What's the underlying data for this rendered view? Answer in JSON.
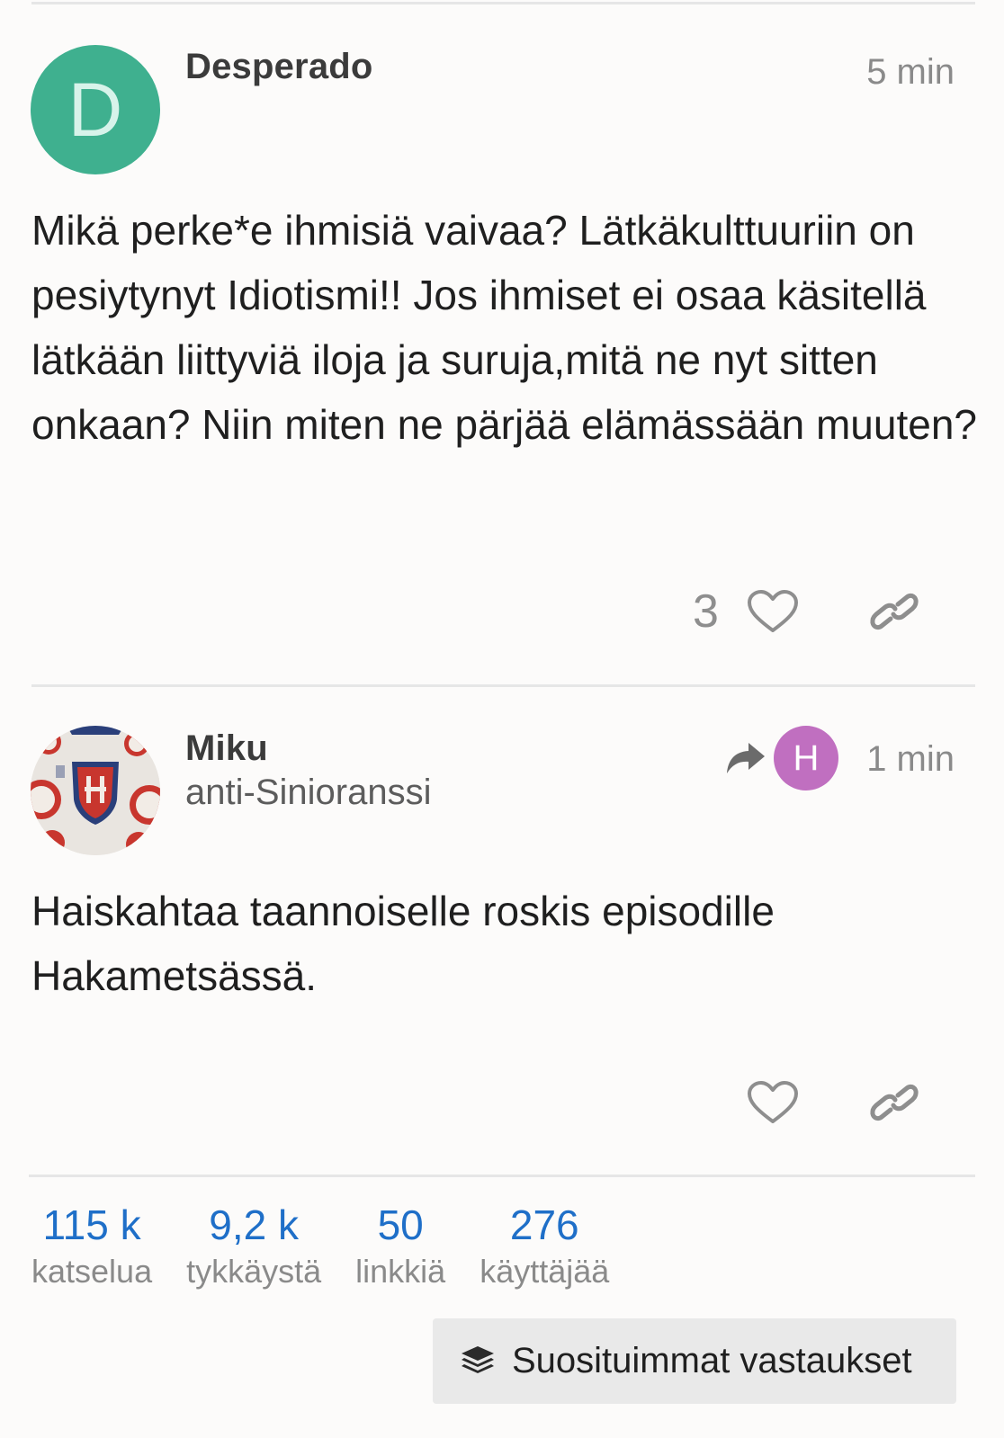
{
  "posts": [
    {
      "author": "Desperado",
      "avatar_letter": "D",
      "avatar_color": "#3fb08f",
      "time": "5 min",
      "body": "Mikä perke*e ihmisiä vaivaa? Lätkäkulttuuriin on pesiytynyt Idiotismi!! Jos ihmiset ei osaa käsitellä lätkään liittyviä iloja ja suruja,mitä ne nyt sitten onkaan? Niin miten ne pärjää elämässään muuten?",
      "like_count": "3"
    },
    {
      "author": "Miku",
      "user_title": "anti-Sinioranssi",
      "reply_to_letter": "H",
      "reply_to_color": "#c06fc0",
      "time": "1 min",
      "body": "Haiskahtaa taannoiselle roskis episodille Hakametsässä."
    }
  ],
  "stats": [
    {
      "value": "115 k",
      "label": "katselua"
    },
    {
      "value": "9,2 k",
      "label": "tykkäystä"
    },
    {
      "value": "50",
      "label": "linkkiä"
    },
    {
      "value": "276",
      "label": "käyttäjää"
    }
  ],
  "top_replies_button": "Suosituimmat vastaukset",
  "accent_color": "#1f6fc8"
}
